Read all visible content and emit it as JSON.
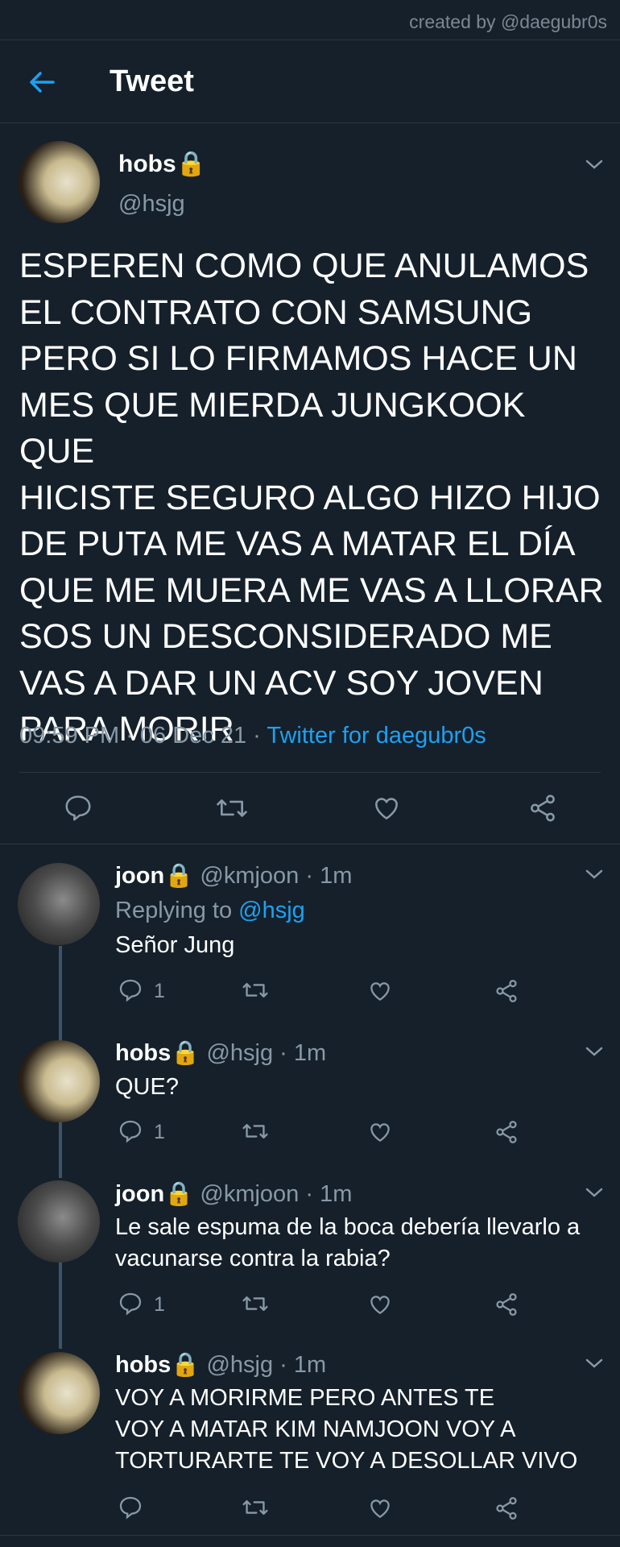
{
  "credit": "created by @daegubr0s",
  "header": {
    "title": "Tweet"
  },
  "main_tweet": {
    "name": "hobs🔒",
    "handle": "@hsjg",
    "text": "ESPEREN COMO QUE ANULAMOS\nEL CONTRATO CON SAMSUNG\nPERO SI LO FIRMAMOS HACE UN\nMES QUE MIERDA JUNGKOOK QUE\nHICISTE SEGURO ALGO HIZO HIJO\nDE PUTA ME VAS A MATAR EL DÍA\nQUE ME MUERA ME VAS A LLORAR\nSOS UN DESCONSIDERADO ME\nVAS A DAR UN ACV SOY JOVEN\nPARA MORIR",
    "meta": "09:59 PM · 06 Dec 21 · ",
    "source": "Twitter for daegubr0s"
  },
  "replies": [
    {
      "name": "joon🔒",
      "handle": "@kmjoon · 1m",
      "replying_label": "Replying to ",
      "replying_to": "@hsjg",
      "text": "Señor Jung",
      "reply_count": "1"
    },
    {
      "name": "hobs🔒",
      "handle": "@hsjg · 1m",
      "text": "QUE?",
      "reply_count": "1"
    },
    {
      "name": "joon🔒",
      "handle": "@kmjoon · 1m",
      "text": "Le sale espuma de la boca debería llevarlo a\nvacunarse contra la rabia?",
      "reply_count": "1"
    },
    {
      "name": "hobs🔒",
      "handle": "@hsjg · 1m",
      "text": "VOY A MORIRME PERO ANTES TE\nVOY A MATAR KIM NAMJOON VOY A\nTORTURARTE TE VOY A DESOLLAR VIVO",
      "reply_count": ""
    }
  ],
  "icons": [
    "back-arrow-icon",
    "chevron-down-icon",
    "reply-icon",
    "retweet-icon",
    "like-icon",
    "share-icon"
  ],
  "colors": {
    "background": "#15202b",
    "accent": "#1da1f2",
    "muted": "#8899a6",
    "divider": "#2b3640"
  }
}
